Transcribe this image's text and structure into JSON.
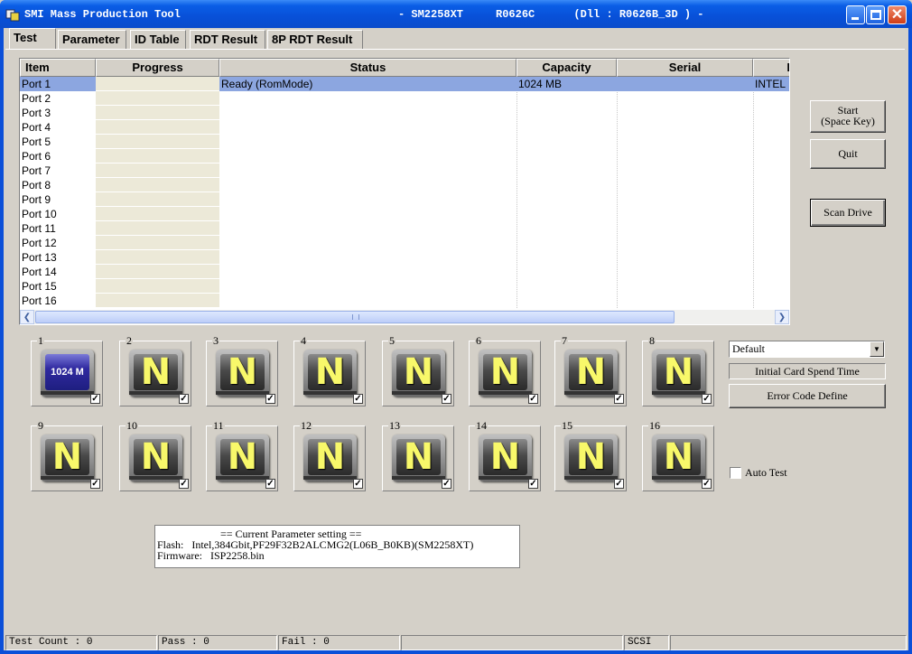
{
  "window": {
    "title": "SMI Mass Production Tool",
    "info": "- SM2258XT     R0626C      (Dll : R0626B_3D ) -"
  },
  "tabs": [
    "Test",
    "Parameter",
    "ID Table",
    "RDT Result",
    "8P RDT Result"
  ],
  "table": {
    "headers": [
      "Item",
      "Progress",
      "Status",
      "Capacity",
      "Serial",
      "I"
    ],
    "rows": [
      {
        "item": "Port 1",
        "status": "Ready (RomMode)",
        "capacity": "1024 MB",
        "serial": "",
        "extra": "INTEL",
        "selected": true
      },
      {
        "item": "Port 2"
      },
      {
        "item": "Port 3"
      },
      {
        "item": "Port 4"
      },
      {
        "item": "Port 5"
      },
      {
        "item": "Port 6"
      },
      {
        "item": "Port 7"
      },
      {
        "item": "Port 8"
      },
      {
        "item": "Port 9"
      },
      {
        "item": "Port 10"
      },
      {
        "item": "Port 11"
      },
      {
        "item": "Port 12"
      },
      {
        "item": "Port 13"
      },
      {
        "item": "Port 14"
      },
      {
        "item": "Port 15"
      },
      {
        "item": "Port 16"
      }
    ]
  },
  "buttons": {
    "start_line1": "Start",
    "start_line2": "(Space Key)",
    "quit": "Quit",
    "scan": "Scan Drive",
    "error_code": "Error Code Define"
  },
  "ports": [
    {
      "num": "1",
      "label": "1024 M",
      "checked": true
    },
    {
      "num": "2",
      "label": "N",
      "checked": true
    },
    {
      "num": "3",
      "label": "N",
      "checked": true
    },
    {
      "num": "4",
      "label": "N",
      "checked": true
    },
    {
      "num": "5",
      "label": "N",
      "checked": true
    },
    {
      "num": "6",
      "label": "N",
      "checked": true
    },
    {
      "num": "7",
      "label": "N",
      "checked": true
    },
    {
      "num": "8",
      "label": "N",
      "checked": true
    },
    {
      "num": "9",
      "label": "N",
      "checked": true
    },
    {
      "num": "10",
      "label": "N",
      "checked": true
    },
    {
      "num": "11",
      "label": "N",
      "checked": true
    },
    {
      "num": "12",
      "label": "N",
      "checked": true
    },
    {
      "num": "13",
      "label": "N",
      "checked": true
    },
    {
      "num": "14",
      "label": "N",
      "checked": true
    },
    {
      "num": "15",
      "label": "N",
      "checked": true
    },
    {
      "num": "16",
      "label": "N",
      "checked": true
    }
  ],
  "combo": {
    "value": "Default"
  },
  "init_time": "Initial Card Spend Time",
  "auto_test": {
    "label": "Auto Test",
    "checked": false
  },
  "parameter": {
    "title": "== Current Parameter setting ==",
    "flash": "Flash:   Intel,384Gbit,PF29F32B2ALCMG2(L06B_B0KB)(SM2258XT)",
    "firmware": "Firmware:   ISP2258.bin"
  },
  "status": {
    "test_count": "Test Count : 0",
    "pass": "Pass : 0",
    "fail": "Fail : 0",
    "blank": "",
    "scsi": "SCSI",
    "last": ""
  },
  "colors": {
    "titlebar": "#0a5ee6",
    "selection": "#8ca6e0",
    "panel": "#d4d0c8"
  }
}
